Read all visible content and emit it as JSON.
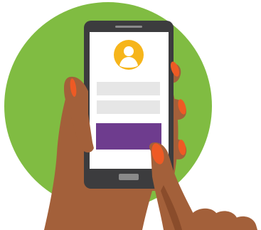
{
  "colors": {
    "background": "#ffffff",
    "circle": "#80bc42",
    "phone_body": "#3c3c3e",
    "phone_screen": "#ffffff",
    "avatar_circle": "#f6b51b",
    "avatar_figure": "#ffffff",
    "input_field": "#e6e6e6",
    "submit_button": "#6e3c8e",
    "home_button": "#8a8a8a",
    "speaker": "#8a8a8a",
    "skin": "#a3603a",
    "skin_shadow": "#8a4c2b",
    "nails": "#ee5a24"
  },
  "illustration": {
    "subject": "hand-holding-phone",
    "screen": {
      "avatar_icon": "user-icon",
      "form_fields": [
        "username-field",
        "password-field"
      ],
      "button": "submit-button"
    }
  }
}
